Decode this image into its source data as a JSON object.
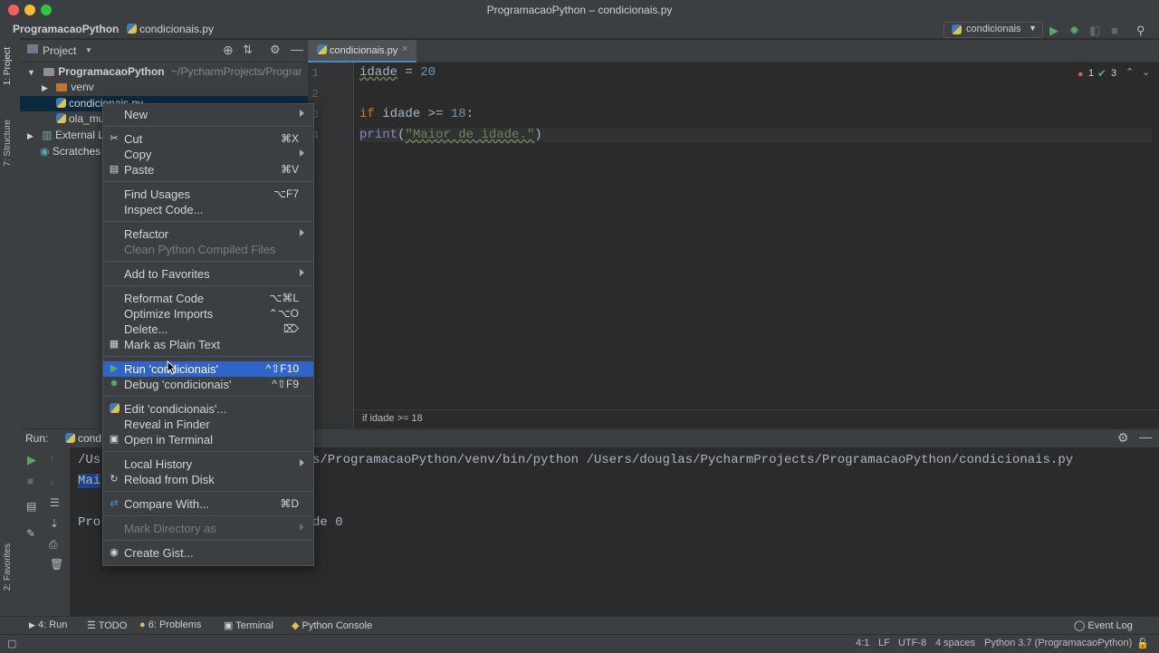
{
  "window": {
    "title": "ProgramacaoPython – condicionais.py"
  },
  "navbar": {
    "project": "ProgramacaoPython",
    "file": "condicionais.py",
    "run_config": "condicionais"
  },
  "project_panel": {
    "title": "Project",
    "root": "ProgramacaoPython",
    "root_path": "~/PycharmProjects/Prograr",
    "items": [
      "venv",
      "condicionais.py",
      "ola_mu",
      "External L",
      "Scratches"
    ]
  },
  "left_stripe": {
    "project_label": "1: Project",
    "structure_label": "7: Structure",
    "favorites_label": "2: Favorites"
  },
  "editor": {
    "tab": "condicionais.py",
    "line_numbers": [
      "1",
      "2",
      "3",
      "4"
    ],
    "inspections": {
      "errors": "1",
      "warnings": "3"
    },
    "breadcrumb": "if idade >= 18"
  },
  "code": {
    "l1_var": "idade",
    "l1_op": " = ",
    "l1_val": "20",
    "l3_kw": "if",
    "l3_mid": " idade >= ",
    "l3_val": "18",
    "l3_end": ":",
    "l4_fn": "print",
    "l4_open": "(",
    "l4_str": "\"Maior de idade.\"",
    "l4_close": ")"
  },
  "run_panel": {
    "label": "Run:",
    "tab": "cond",
    "console": {
      "line1_prefix": "/Us",
      "line1_rest": "s/ProgramacaoPython/venv/bin/python /Users/douglas/PycharmProjects/ProgramacaoPython/condicionais.py",
      "line2": "Mai",
      "line3_prefix": "Pro",
      "line3_rest": "de 0"
    }
  },
  "context_menu": {
    "items": [
      {
        "label": "New",
        "shortcut": "",
        "submenu": true
      },
      {
        "label": "Cut",
        "shortcut": "⌘X",
        "icon": "scissors-icon"
      },
      {
        "label": "Copy",
        "shortcut": "",
        "submenu": true
      },
      {
        "label": "Paste",
        "shortcut": "⌘V",
        "icon": "clipboard-icon"
      },
      {
        "label": "Find Usages",
        "shortcut": "⌥F7"
      },
      {
        "label": "Inspect Code..."
      },
      {
        "label": "Refactor",
        "submenu": true
      },
      {
        "label": "Clean Python Compiled Files",
        "disabled": true
      },
      {
        "label": "Add to Favorites",
        "submenu": true
      },
      {
        "label": "Reformat Code",
        "shortcut": "⌥⌘L"
      },
      {
        "label": "Optimize Imports",
        "shortcut": "⌃⌥O"
      },
      {
        "label": "Delete...",
        "shortcut": "⌦"
      },
      {
        "label": "Mark as Plain Text",
        "icon": "plain-text-icon"
      },
      {
        "label": "Run 'condicionais'",
        "shortcut": "^⇧F10",
        "selected": true,
        "icon": "run-icon"
      },
      {
        "label": "Debug 'condicionais'",
        "shortcut": "^⇧F9",
        "icon": "debug-icon"
      },
      {
        "label": "Edit 'condicionais'...",
        "icon": "python-icon"
      },
      {
        "label": "Reveal in Finder"
      },
      {
        "label": "Open in Terminal",
        "icon": "terminal-icon"
      },
      {
        "label": "Local History",
        "submenu": true
      },
      {
        "label": "Reload from Disk",
        "icon": "reload-icon"
      },
      {
        "label": "Compare With...",
        "shortcut": "⌘D",
        "icon": "compare-icon"
      },
      {
        "label": "Mark Directory as",
        "disabled": true,
        "submenu": true
      },
      {
        "label": "Create Gist...",
        "icon": "github-icon"
      }
    ]
  },
  "tool_windows": {
    "run": "4: Run",
    "todo": "TODO",
    "problems": "6: Problems",
    "terminal": "Terminal",
    "python_console": "Python Console",
    "event_log": "Event Log"
  },
  "status_bar": {
    "position": "4:1",
    "line_sep": "LF",
    "encoding": "UTF-8",
    "indent": "4 spaces",
    "interpreter": "Python 3.7 (ProgramacaoPython)"
  },
  "colors": {
    "selection": "#2f65ca",
    "run_green": "#59a869",
    "keyword": "#cc7832",
    "number": "#6897bb",
    "string": "#6a8759"
  }
}
